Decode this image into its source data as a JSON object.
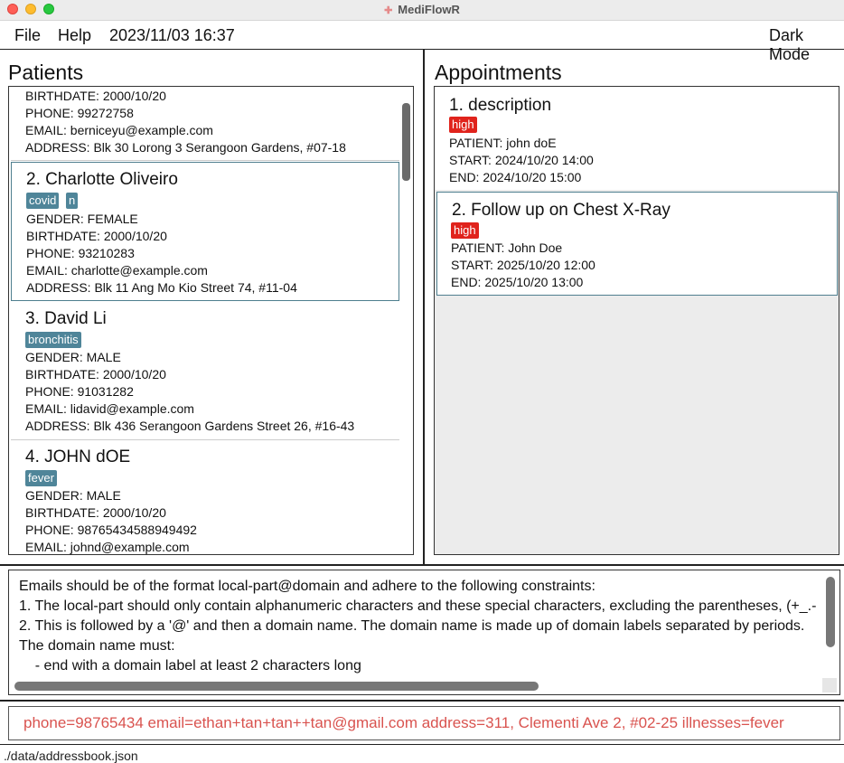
{
  "window": {
    "title": "MediFlowR"
  },
  "menu": {
    "file": "File",
    "help": "Help",
    "datetime": "2023/11/03 16:37",
    "dark_mode": "Dark Mode"
  },
  "patients": {
    "title": "Patients",
    "partial": {
      "birthdate": "BIRTHDATE: 2000/10/20",
      "phone": "PHONE: 99272758",
      "email": "EMAIL: berniceyu@example.com",
      "address": "ADDRESS: Blk 30 Lorong 3 Serangoon Gardens, #07-18"
    },
    "items": [
      {
        "index_name": "2.  Charlotte Oliveiro",
        "tags": [
          "covid",
          "n"
        ],
        "gender": "GENDER: FEMALE",
        "birthdate": "BIRTHDATE: 2000/10/20",
        "phone": "PHONE: 93210283",
        "email": "EMAIL: charlotte@example.com",
        "address": "ADDRESS: Blk 11 Ang Mo Kio Street 74, #11-04"
      },
      {
        "index_name": "3.  David Li",
        "tags": [
          "bronchitis"
        ],
        "gender": "GENDER: MALE",
        "birthdate": "BIRTHDATE: 2000/10/20",
        "phone": "PHONE: 91031282",
        "email": "EMAIL: lidavid@example.com",
        "address": "ADDRESS: Blk 436 Serangoon Gardens Street 26, #16-43"
      },
      {
        "index_name": "4.  JOHN dOE",
        "tags": [
          "fever"
        ],
        "gender": "GENDER: MALE",
        "birthdate": "BIRTHDATE: 2000/10/20",
        "phone": "PHONE: 98765434588949492",
        "email": "EMAIL: johnd@example.com"
      }
    ]
  },
  "appointments": {
    "title": "Appointments",
    "items": [
      {
        "index_desc": "1.  description",
        "priority": "high",
        "patient": "PATIENT: john doE",
        "start": "START: 2024/10/20 14:00",
        "end": "END: 2024/10/20 15:00"
      },
      {
        "index_desc": "2.  Follow up on Chest X-Ray",
        "priority": "high",
        "patient": "PATIENT: John Doe",
        "start": "START: 2025/10/20 12:00",
        "end": "END: 2025/10/20 13:00"
      }
    ]
  },
  "result": {
    "lines": [
      "Emails should be of the format local-part@domain and adhere to the following constraints:",
      "1. The local-part should only contain alphanumeric characters and these special characters, excluding the parentheses, (+_.-",
      "2. This is followed by a '@' and then a domain name. The domain name is made up of domain labels separated by periods.",
      "The domain name must:",
      "    - end with a domain label at least 2 characters long"
    ]
  },
  "command": {
    "value": "phone=98765434 email=ethan+tan+tan++tan@gmail.com address=311, Clementi Ave 2, #02-25 illnesses=fever"
  },
  "status": {
    "path": "./data/addressbook.json"
  }
}
